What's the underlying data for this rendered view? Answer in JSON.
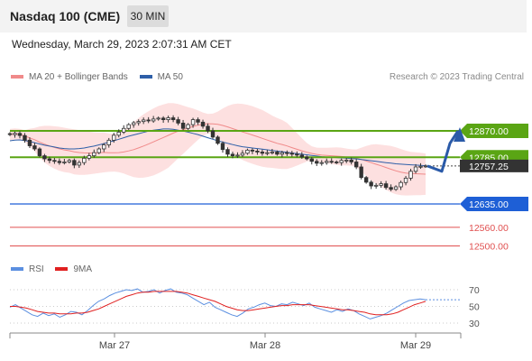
{
  "header": {
    "title": "Nasdaq 100 (CME)",
    "timeframe": "30 MIN"
  },
  "datetime": "Wednesday, March 29, 2023 2:07:31 AM CET",
  "legend": {
    "bollinger": "MA 20 + Bollinger Bands",
    "ma50": "MA 50",
    "research": "Research © 2023 Trading Central"
  },
  "rsi_legend": {
    "rsi": "RSI",
    "ma": "9MA"
  },
  "colors": {
    "bollinger": "#f08a8a",
    "bollinger_fill": "#fde0e0",
    "ma50": "#2e5fa8",
    "green_level": "#5aa514",
    "blue_level": "#1e5fd6",
    "red_level": "#e05050",
    "arrow": "#2a5aa8",
    "rsi": "#5b8fe0",
    "rsi_ma": "#e02020"
  },
  "chart_data": [
    {
      "type": "line",
      "subtype": "candlestick",
      "x_ticks": [
        "Mar 27",
        "Mar 28",
        "Mar 29"
      ],
      "current_price": "12757.25",
      "levels": [
        {
          "value": 12870.0,
          "label": "12870.00",
          "kind": "resistance"
        },
        {
          "value": 12785.0,
          "label": "12785.00",
          "kind": "pivot"
        },
        {
          "value": 12635.0,
          "label": "12635.00",
          "kind": "support"
        },
        {
          "value": 12560.0,
          "label": "12560.00",
          "kind": "support"
        },
        {
          "value": 12500.0,
          "label": "12500.00",
          "kind": "support"
        }
      ],
      "close_series": [
        12858,
        12862,
        12855,
        12840,
        12822,
        12812,
        12790,
        12780,
        12775,
        12772,
        12768,
        12770,
        12775,
        12760,
        12768,
        12782,
        12790,
        12800,
        12812,
        12825,
        12840,
        12856,
        12866,
        12878,
        12890,
        12896,
        12900,
        12905,
        12902,
        12908,
        12911,
        12906,
        12912,
        12906,
        12895,
        12878,
        12890,
        12906,
        12898,
        12885,
        12870,
        12850,
        12830,
        12810,
        12795,
        12790,
        12792,
        12798,
        12808,
        12805,
        12802,
        12798,
        12800,
        12802,
        12795,
        12800,
        12798,
        12795,
        12792,
        12786,
        12780,
        12772,
        12766,
        12768,
        12772,
        12770,
        12768,
        12775,
        12776,
        12770,
        12754,
        12720,
        12705,
        12693,
        12695,
        12700,
        12688,
        12682,
        12690,
        12704,
        12718,
        12740,
        12754,
        12756,
        12757.25
      ],
      "ma50_series": [
        12838,
        12840,
        12841,
        12839,
        12836,
        12832,
        12828,
        12824,
        12821,
        12818,
        12815,
        12813,
        12812,
        12812,
        12813,
        12815,
        12818,
        12821,
        12825,
        12829,
        12834,
        12838,
        12843,
        12848,
        12853,
        12857,
        12861,
        12865,
        12869,
        12872,
        12874,
        12876,
        12876,
        12875,
        12872,
        12869,
        12866,
        12862,
        12858,
        12853,
        12848,
        12843,
        12838,
        12834,
        12830,
        12826,
        12822,
        12819,
        12817,
        12815,
        12813,
        12811,
        12809,
        12807,
        12805,
        12803,
        12801,
        12799,
        12797,
        12795,
        12793,
        12791,
        12789,
        12787,
        12786,
        12785,
        12784,
        12783,
        12782,
        12781,
        12780,
        12778,
        12776,
        12774,
        12772,
        12770,
        12768,
        12766,
        12764,
        12763,
        12762,
        12761,
        12760,
        12759,
        12758
      ],
      "forecast": [
        12757.25,
        12740,
        12830,
        12870
      ]
    },
    {
      "type": "line",
      "title": "RSI",
      "y_ticks": [
        70,
        50,
        30
      ],
      "ylim": [
        20,
        80
      ],
      "series": [
        {
          "name": "RSI",
          "values": [
            49,
            52,
            48,
            44,
            40,
            38,
            42,
            39,
            41,
            37,
            40,
            44,
            43,
            40,
            45,
            51,
            56,
            59,
            63,
            66,
            68,
            70,
            69,
            71,
            67,
            68,
            70,
            66,
            69,
            71,
            67,
            66,
            64,
            60,
            56,
            52,
            55,
            49,
            46,
            43,
            40,
            38,
            42,
            47,
            49,
            52,
            54,
            51,
            50,
            53,
            52,
            55,
            53,
            51,
            54,
            49,
            47,
            45,
            43,
            46,
            44,
            47,
            45,
            41,
            38,
            35,
            37,
            39,
            42,
            46,
            50,
            54,
            57,
            58,
            59,
            58
          ]
        },
        {
          "name": "9MA",
          "values": [
            50,
            50,
            49,
            48,
            46,
            44,
            43,
            42,
            42,
            41,
            41,
            41,
            42,
            42,
            43,
            45,
            47,
            50,
            53,
            56,
            59,
            62,
            64,
            66,
            67,
            67,
            68,
            68,
            68,
            68,
            68,
            67,
            66,
            64,
            62,
            60,
            58,
            56,
            53,
            50,
            48,
            46,
            45,
            45,
            46,
            47,
            48,
            49,
            50,
            51,
            51,
            52,
            52,
            52,
            52,
            51,
            50,
            49,
            48,
            47,
            46,
            46,
            45,
            44,
            43,
            41,
            40,
            40,
            40,
            41,
            43,
            46,
            49,
            52,
            54,
            56
          ]
        }
      ]
    }
  ]
}
